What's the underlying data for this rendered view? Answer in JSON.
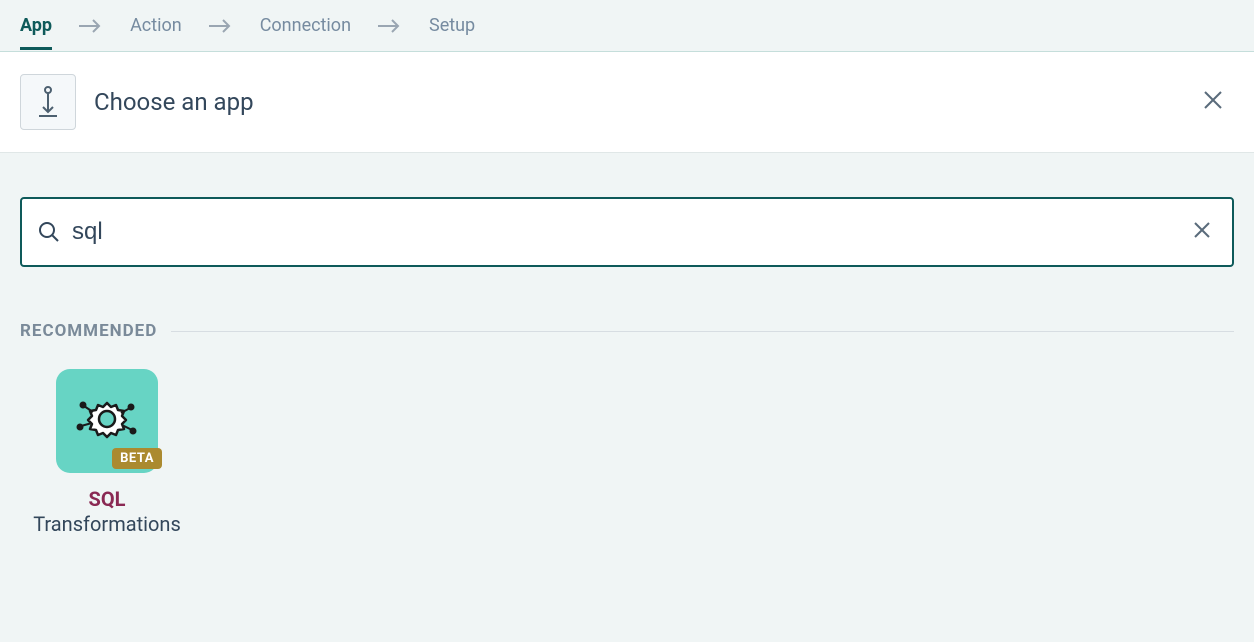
{
  "stepper": {
    "steps": [
      "App",
      "Action",
      "Connection",
      "Setup"
    ],
    "active_index": 0
  },
  "header": {
    "title": "Choose an app"
  },
  "search": {
    "value": "sql",
    "placeholder": ""
  },
  "section": {
    "label": "RECOMMENDED"
  },
  "results": [
    {
      "badge": "BETA",
      "title_highlight": "SQL",
      "title_rest": " Transformations"
    }
  ]
}
